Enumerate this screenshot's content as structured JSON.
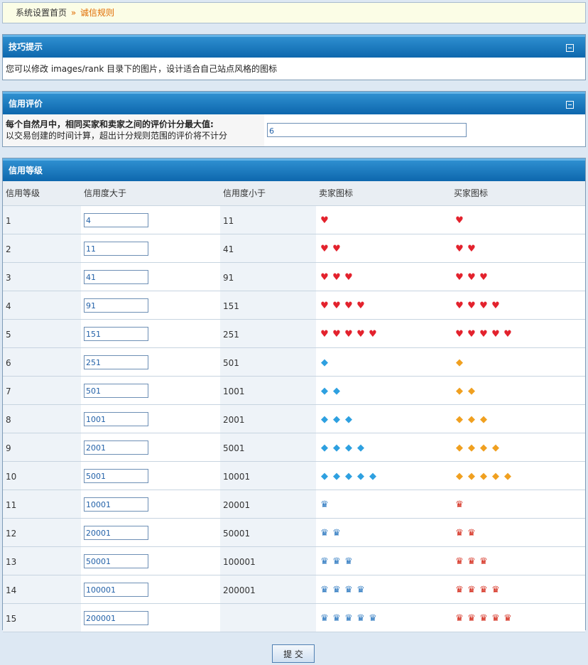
{
  "breadcrumb": {
    "home": "系统设置首页",
    "sep": "»",
    "current": "诚信规则"
  },
  "tips": {
    "title": "技巧提示",
    "text": "您可以修改 images/rank 目录下的图片，设计适合自己站点风格的图标"
  },
  "credit_eval": {
    "title": "信用评价",
    "label_bold": "每个自然月中，相同买家和卖家之间的评价计分最大值:",
    "label_sub": "以交易创建的时间计算，超出计分规则范围的评价将不计分",
    "value": "6"
  },
  "credit_level": {
    "title": "信用等级",
    "headers": [
      "信用等级",
      "信用度大于",
      "信用度小于",
      "卖家图标",
      "买家图标"
    ],
    "rows": [
      {
        "level": "1",
        "min": "4",
        "max": "11",
        "icon": "heart",
        "count": 1
      },
      {
        "level": "2",
        "min": "11",
        "max": "41",
        "icon": "heart",
        "count": 2
      },
      {
        "level": "3",
        "min": "41",
        "max": "91",
        "icon": "heart",
        "count": 3
      },
      {
        "level": "4",
        "min": "91",
        "max": "151",
        "icon": "heart",
        "count": 4
      },
      {
        "level": "5",
        "min": "151",
        "max": "251",
        "icon": "heart",
        "count": 5
      },
      {
        "level": "6",
        "min": "251",
        "max": "501",
        "icon": "diamond",
        "count": 1
      },
      {
        "level": "7",
        "min": "501",
        "max": "1001",
        "icon": "diamond",
        "count": 2
      },
      {
        "level": "8",
        "min": "1001",
        "max": "2001",
        "icon": "diamond",
        "count": 3
      },
      {
        "level": "9",
        "min": "2001",
        "max": "5001",
        "icon": "diamond",
        "count": 4
      },
      {
        "level": "10",
        "min": "5001",
        "max": "10001",
        "icon": "diamond",
        "count": 5
      },
      {
        "level": "11",
        "min": "10001",
        "max": "20001",
        "icon": "crown",
        "count": 1
      },
      {
        "level": "12",
        "min": "20001",
        "max": "50001",
        "icon": "crown",
        "count": 2
      },
      {
        "level": "13",
        "min": "50001",
        "max": "100001",
        "icon": "crown",
        "count": 3
      },
      {
        "level": "14",
        "min": "100001",
        "max": "200001",
        "icon": "crown",
        "count": 4
      },
      {
        "level": "15",
        "min": "200001",
        "max": "",
        "icon": "crown",
        "count": 5
      }
    ]
  },
  "submit_label": "提 交",
  "colors": {
    "header_blue": "#1a78c0",
    "breadcrumb_accent": "#e06b00",
    "heart": "#e3222d",
    "seller_diamond": "#2ea0e0",
    "buyer_diamond": "#f0a020",
    "seller_crown": "#2c78c0",
    "buyer_crown": "#d42818"
  }
}
